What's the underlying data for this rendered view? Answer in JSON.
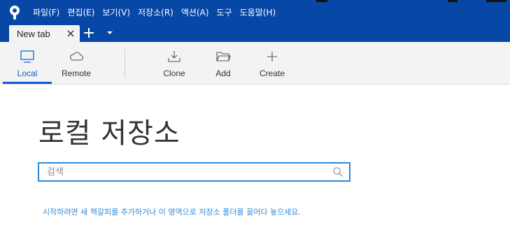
{
  "menu": {
    "items": [
      "파일(F)",
      "편집(E)",
      "보기(V)",
      "저장소(R)",
      "액션(A)",
      "도구",
      "도움말(H)"
    ]
  },
  "tabs": {
    "active_label": "New tab"
  },
  "toolbar": {
    "local_label": "Local",
    "remote_label": "Remote",
    "clone_label": "Clone",
    "add_label": "Add",
    "create_label": "Create"
  },
  "main": {
    "title": "로컬 저장소",
    "search_placeholder": "검색",
    "hint": "시작하려면 새 책갈피를 추가하거나 이 영역으로 저장소 폴더를 끌어다 놓으세요."
  },
  "colors": {
    "titlebar": "#0747a6",
    "accent": "#0b5cd5",
    "hint": "#2e8ad8"
  }
}
